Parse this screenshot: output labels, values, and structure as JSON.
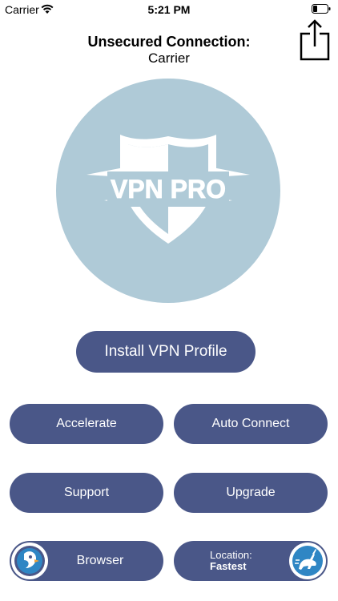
{
  "status_bar": {
    "carrier": "Carrier",
    "time": "5:21 PM",
    "icons": [
      "wifi-icon",
      "battery-icon"
    ]
  },
  "header": {
    "connection_status": "Unsecured Connection:",
    "network": "Carrier"
  },
  "logo": {
    "text": "VPN PRO",
    "circle_color": "#afcad7"
  },
  "buttons": {
    "install": "Install VPN Profile",
    "accelerate": "Accelerate",
    "auto_connect": "Auto Connect",
    "support": "Support",
    "upgrade": "Upgrade",
    "browser": "Browser",
    "location_label": "Location:",
    "location_value": "Fastest"
  },
  "colors": {
    "button": "#4a5788",
    "button_text": "#ffffff",
    "accent_blue": "#2f86c4"
  }
}
